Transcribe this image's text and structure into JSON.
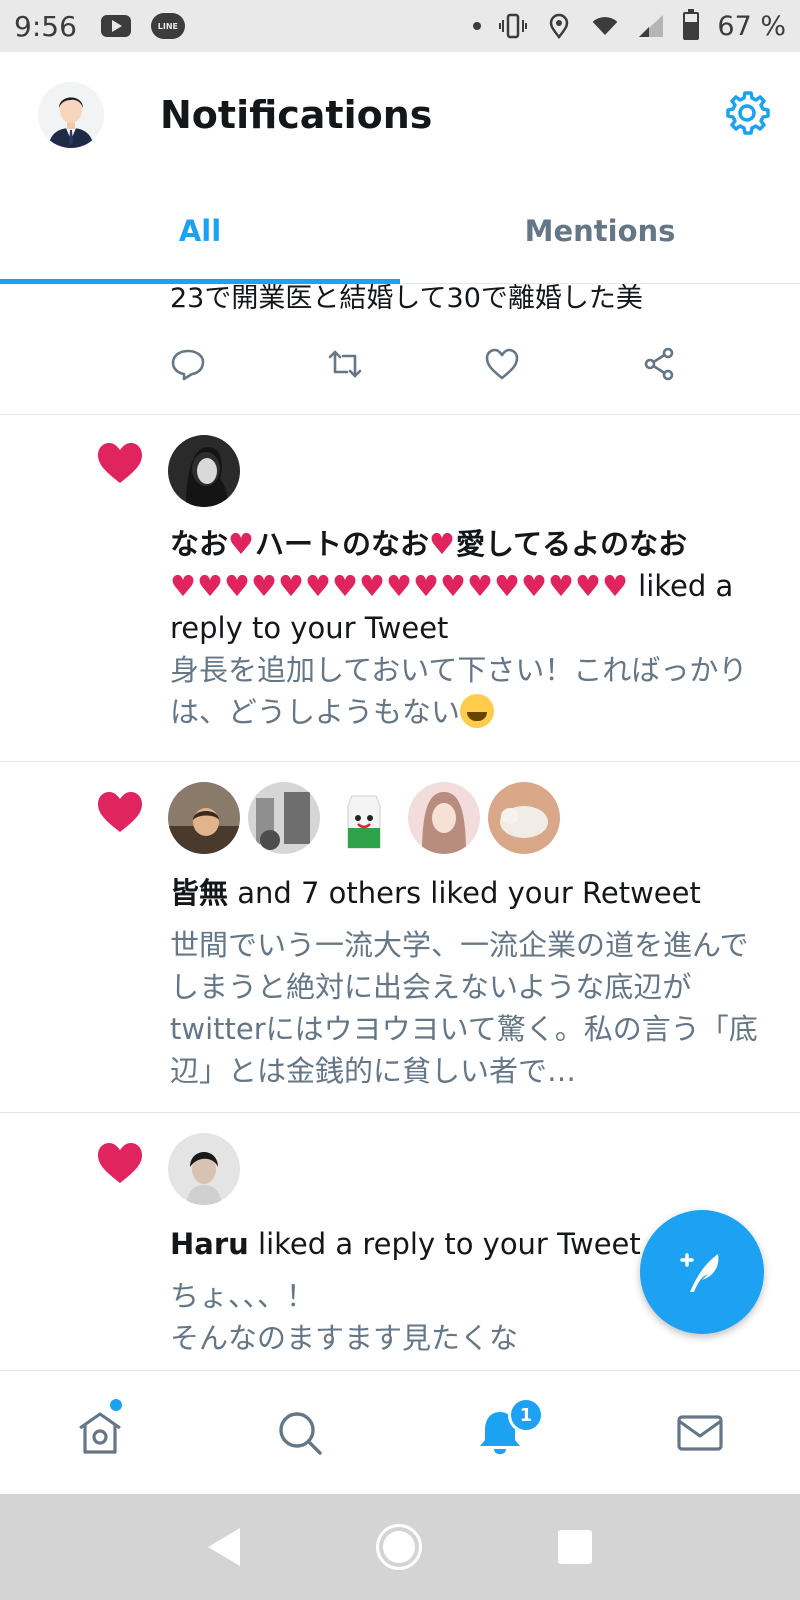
{
  "status_bar": {
    "time": "9:56",
    "line_app": "LINE",
    "battery": "67 %",
    "battery_level": 0.67
  },
  "header": {
    "title": "Notifications",
    "avatar_icon": "profile-avatar",
    "settings_icon": "gear-icon"
  },
  "tabs": [
    {
      "label": "All",
      "active": true
    },
    {
      "label": "Mentions",
      "active": false
    }
  ],
  "tweet_partial": {
    "text": "23で開業医と結婚して30で離婚した美"
  },
  "notifications": [
    {
      "type": "like",
      "actor_part1": "なお",
      "actor_part2": "ハートのなお",
      "actor_part3": "愛してるよのなお",
      "hearts": "♥♥♥♥♥♥♥♥♥♥♥♥♥♥♥♥♥",
      "action": " liked a reply to your Tweet",
      "preview": "身長を追加しておいて下さい！こればっかりは、どうしようもない"
    },
    {
      "type": "like",
      "actor": "皆無",
      "action": " and 7 others liked your Retweet",
      "preview": "世間でいう一流大学、一流企業の道を進んでしまうと絶対に出会えないような底辺がtwitterにはウヨウヨいて驚く。私の言う「底辺」とは金銭的に貧しい者で…"
    },
    {
      "type": "like",
      "actor": "Haru",
      "action": " liked a reply to your Tweet",
      "preview": "ちょ、、、！",
      "preview2": "そんなのますます見たくな"
    }
  ],
  "bottom_nav": {
    "items": [
      "home",
      "search",
      "notifications",
      "messages"
    ],
    "badge": "1"
  },
  "colors": {
    "accent": "#1da1f2",
    "like": "#e0245e",
    "secondary_text": "#657786"
  }
}
